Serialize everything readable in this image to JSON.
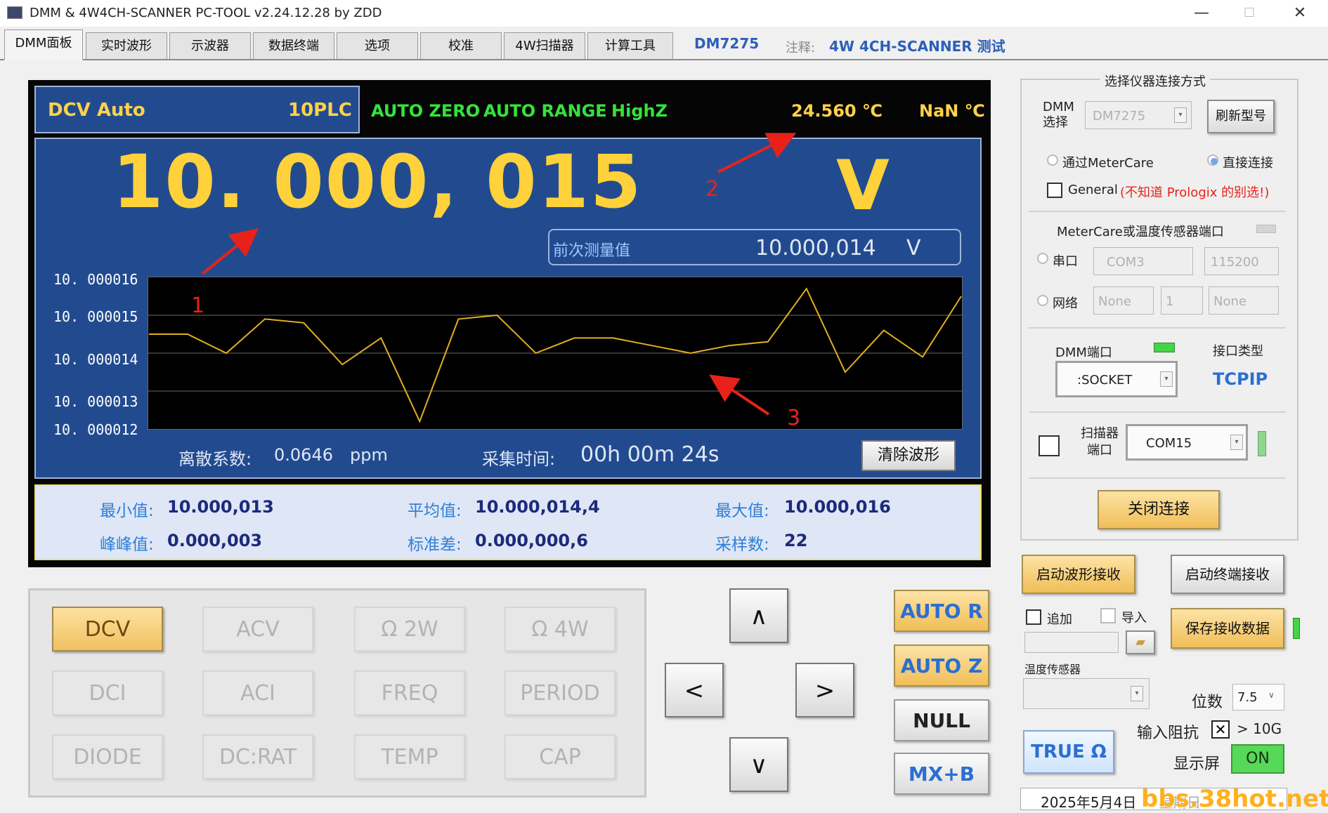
{
  "window": {
    "title": "DMM & 4W4CH-SCANNER PC-TOOL v2.24.12.28 by ZDD",
    "minimize": "—",
    "maximize": "☐",
    "close": "✕"
  },
  "tabs": [
    "DMM面板",
    "实时波形",
    "示波器",
    "数据终端",
    "选项",
    "校准",
    "4W扫描器",
    "计算工具"
  ],
  "tab_info": {
    "model": "DM7275",
    "note_label": "注释:",
    "note": "4W 4CH-SCANNER 测试"
  },
  "display": {
    "mode": "DCV  Auto",
    "plc": "10PLC",
    "auto_zero": "AUTO ZERO",
    "auto_range": "AUTO RANGE",
    "highz": "HighZ",
    "temp1": "24.560 ℃",
    "temp2": "NaN ℃",
    "main_value": "10. 000, 015",
    "main_unit": "V",
    "prev_label": "前次测量值",
    "prev_value": "10.000,014",
    "prev_unit": "V",
    "dispersion_label": "离散系数:",
    "dispersion_value": "0.0646",
    "dispersion_unit": "ppm",
    "time_label": "采集时间:",
    "time_value": "00h 00m 24s",
    "clear_button": "清除波形"
  },
  "chart_data": {
    "type": "line",
    "y_ticks": [
      "10. 000016",
      "10. 000015",
      "10. 000014",
      "10. 000013",
      "10. 000012"
    ],
    "ylim": [
      10.000012,
      10.000016
    ],
    "grid": true,
    "color": "#e0b020",
    "series": [
      {
        "values": [
          10.0000145,
          10.0000145,
          10.000014,
          10.0000149,
          10.0000148,
          10.0000137,
          10.0000144,
          10.0000122,
          10.0000149,
          10.000015,
          10.000014,
          10.0000144,
          10.0000144,
          10.0000142,
          10.000014,
          10.0000142,
          10.0000143,
          10.0000157,
          10.0000135,
          10.0000146,
          10.0000139,
          10.0000155
        ]
      }
    ]
  },
  "stats": [
    {
      "label": "最小值:",
      "value": "10.000,013"
    },
    {
      "label": "平均值:",
      "value": "10.000,014,4"
    },
    {
      "label": "最大值:",
      "value": "10.000,016"
    },
    {
      "label": "峰峰值:",
      "value": "0.000,003"
    },
    {
      "label": "标准差:",
      "value": "0.000,000,6"
    },
    {
      "label": "采样数:",
      "value": "22"
    }
  ],
  "annotations": [
    "1",
    "2",
    "3"
  ],
  "function_keys": [
    {
      "label": "DCV",
      "selected": true
    },
    {
      "label": "ACV"
    },
    {
      "label": "Ω 2W"
    },
    {
      "label": "Ω 4W"
    },
    {
      "label": "DCI"
    },
    {
      "label": "ACI"
    },
    {
      "label": "FREQ"
    },
    {
      "label": "PERIOD"
    },
    {
      "label": "DIODE"
    },
    {
      "label": "DC:RAT"
    },
    {
      "label": "TEMP"
    },
    {
      "label": "CAP"
    }
  ],
  "arrows": {
    "up": "∧",
    "left": "<",
    "right": ">",
    "down": "∨"
  },
  "options": {
    "auto_r": "AUTO R",
    "auto_z": "AUTO Z",
    "null": "NULL",
    "mxb": "MX+B"
  },
  "connection": {
    "group_title": "选择仪器连接方式",
    "dmm_select_label": "DMM\n选择",
    "dmm_model": "DM7275",
    "refresh_button": "刷新型号",
    "radio_metercare": "通过MeterCare",
    "radio_direct": "直接连接",
    "general_label": "General",
    "general_note": "(不知道 Prologix 的别选!)",
    "metercare_port_label": "MeterCare或温度传感器端口",
    "serial_label": "串口",
    "com_value": "COM3",
    "baud_value": "115200",
    "net_label": "网络",
    "net_opt1": "None",
    "net_opt2": "1",
    "net_opt3": "None",
    "dmm_port_label": "DMM端口",
    "iface_label": "接口类型",
    "socket_value": ":SOCKET",
    "iface_value": "TCPIP",
    "scanner_label": "扫描器\n端口",
    "scanner_value": "COM15",
    "close_button": "关闭连接"
  },
  "receive": {
    "wave_button": "启动波形接收",
    "term_button": "启动终端接收",
    "append_label": "追加",
    "import_label": "导入",
    "save_button": "保存接收数据",
    "temp_sensor_label": "温度传感器",
    "digits_label": "位数",
    "digits_value": "7.5",
    "input_imp_label": "输入阻抗",
    "input_imp_value": "> 10G",
    "display_label": "显示屏",
    "display_value": "ON",
    "true_ohm": "TRUE Ω"
  },
  "footer": {
    "date": "2025年5月4日",
    "weekday": "星期日",
    "watermark": "bbs.38hot.net"
  }
}
